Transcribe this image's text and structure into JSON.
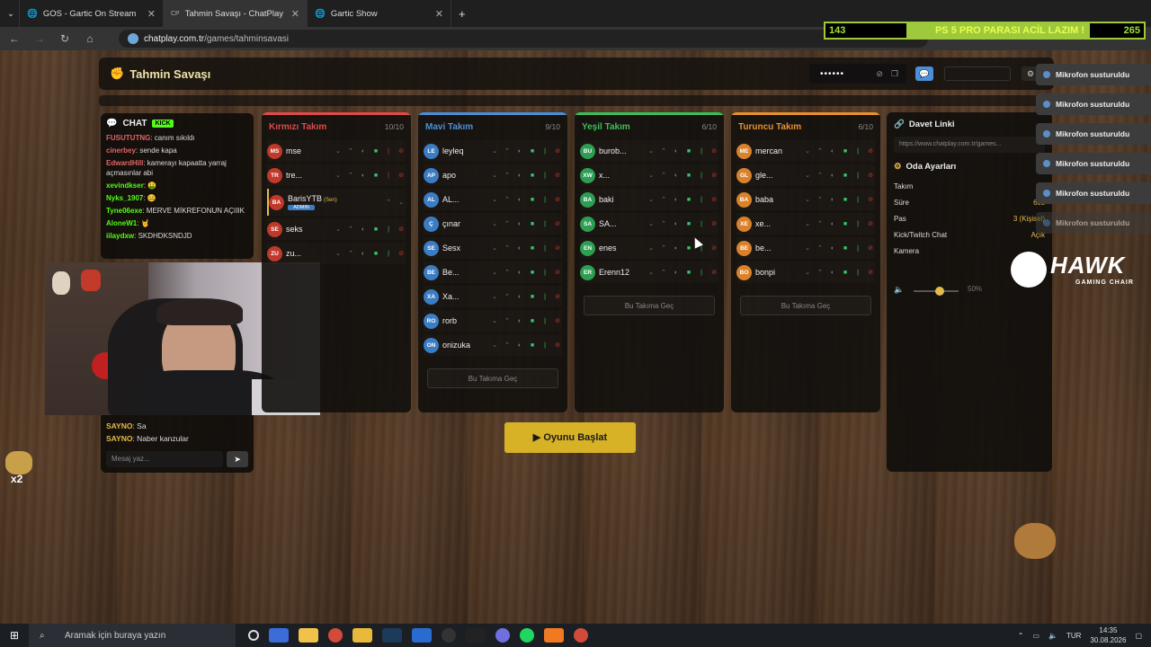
{
  "browser": {
    "tabs": [
      {
        "label": "GOS - Gartic On Stream"
      },
      {
        "label": "Tahmin Savaşı - ChatPlay"
      },
      {
        "label": "Gartic Show"
      }
    ],
    "url_host": "chatplay.com.tr",
    "url_path": "/games/tahminsavasi"
  },
  "ticker": {
    "left": "143",
    "middle": "PS 5 PRO PARASI ACİL LAZIM !",
    "right": "265"
  },
  "app": {
    "title": "Tahmin Savaşı",
    "password_mask": "••••••",
    "chat_title": "CHAT",
    "chat_badge": "KICK",
    "chat_messages": [
      {
        "user": "FUSUTUTNG",
        "text": ": canım sıkıldı",
        "color": "#e06666"
      },
      {
        "user": "cinerbey",
        "text": ": sende kapa",
        "color": "#e06666"
      },
      {
        "user": "EdwardHill",
        "text": ": kamerayı kapaatta yarraj açmasınlar abi",
        "color": "#e06666"
      },
      {
        "user": "xevindkser",
        "text": ": 🤑",
        "color": "#53fc18"
      },
      {
        "user": "Nyks_1907",
        "text": ": 🤐",
        "color": "#53fc18"
      },
      {
        "user": "Tyne06exe",
        "text": ": MERVE MİKREFONUN AÇIIIK",
        "color": "#53fc18"
      },
      {
        "user": "AloneW1",
        "text": ": 🤘",
        "color": "#53fc18"
      },
      {
        "user": "iilaydxw",
        "text": ": SKDHDKSNDJD",
        "color": "#53fc18"
      }
    ],
    "chat_bottom": [
      {
        "user": "SAYNO",
        "text": ": Sa"
      },
      {
        "user": "SAYNO",
        "text": ": Naber kanzular"
      }
    ],
    "chat_placeholder": "Mesaj yaz...",
    "teams": [
      {
        "name": "Kırmızı Takım",
        "count": "10/10",
        "color": "#e04a4a",
        "players": [
          {
            "initials": "MS",
            "name": "mse"
          },
          {
            "initials": "TR",
            "name": "tre..."
          },
          {
            "initials": "BA",
            "name": "BarisYTB",
            "tag": "(Sen)",
            "badge": "ADMIN"
          },
          {
            "initials": "SE",
            "name": "seks"
          },
          {
            "initials": "ZU",
            "name": "zu..."
          }
        ]
      },
      {
        "name": "Mavi Takım",
        "count": "9/10",
        "color": "#4a90d9",
        "players": [
          {
            "initials": "LE",
            "name": "leyleq"
          },
          {
            "initials": "AP",
            "name": "apo"
          },
          {
            "initials": "AL",
            "name": "AL..."
          },
          {
            "initials": "Ç",
            "name": "çınar"
          },
          {
            "initials": "SE",
            "name": "Sesx"
          },
          {
            "initials": "BE",
            "name": "Be..."
          },
          {
            "initials": "XA",
            "name": "Xa..."
          },
          {
            "initials": "RO",
            "name": "rorb"
          },
          {
            "initials": "ON",
            "name": "onizuka"
          }
        ],
        "join": "Bu Takıma Geç"
      },
      {
        "name": "Yeşil Takım",
        "count": "6/10",
        "color": "#3bbf5c",
        "players": [
          {
            "initials": "BU",
            "name": "burob..."
          },
          {
            "initials": "XW",
            "name": "x..."
          },
          {
            "initials": "BA",
            "name": "baki"
          },
          {
            "initials": "SA",
            "name": "SA..."
          },
          {
            "initials": "EN",
            "name": "enes"
          },
          {
            "initials": "ER",
            "name": "Erenn12"
          }
        ],
        "join": "Bu Takıma Geç"
      },
      {
        "name": "Turuncu Takım",
        "count": "6/10",
        "color": "#e8912f",
        "players": [
          {
            "initials": "ME",
            "name": "mercan"
          },
          {
            "initials": "GL",
            "name": "gle..."
          },
          {
            "initials": "BA",
            "name": "baba"
          },
          {
            "initials": "XE",
            "name": "xe..."
          },
          {
            "initials": "BE",
            "name": "be..."
          },
          {
            "initials": "BO",
            "name": "bonpi"
          }
        ],
        "join": "Bu Takıma Geç"
      }
    ],
    "start_button": "Oyunu Başlat",
    "invite_title": "Davet Linki",
    "invite_url": "https://www.chatplay.com.tr/games...",
    "room_title": "Oda Ayarları",
    "settings": [
      {
        "label": "Takım",
        "value": ""
      },
      {
        "label": "Süre",
        "value": "60s"
      },
      {
        "label": "Pas",
        "value": "3 (Kişisel)"
      },
      {
        "label": "Kick/Twitch Chat",
        "value": "Açık"
      },
      {
        "label": "Kamera",
        "value": ""
      }
    ],
    "volume": "50%"
  },
  "notifications": [
    "Mikrofon susturuldu",
    "Mikrofon susturuldu",
    "Mikrofon susturuldu",
    "Mikrofon susturuldu",
    "Mikrofon susturuldu",
    "Mikrofon susturuldu"
  ],
  "sponsor": {
    "brand": "HAWK",
    "sub": "GAMING CHAIR"
  },
  "overlay_text": "x2",
  "taskbar": {
    "search": "Aramak için buraya yazın",
    "lang": "TUR",
    "time": "14:35",
    "date": "30.08.2026"
  }
}
